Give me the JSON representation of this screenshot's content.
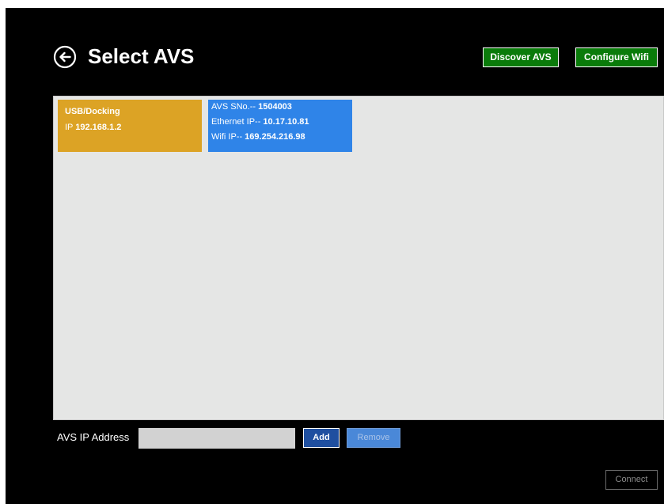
{
  "colors": {
    "background": "#000000",
    "primary_button": "#0a7b0a",
    "usb_tile": "#dca325",
    "avs_tile": "#2f84e8",
    "add_button": "#1f4fa0",
    "remove_button": "#4a88d8",
    "panel": "#e5e6e5"
  },
  "header": {
    "back_icon": "back-arrow-circle-icon",
    "title": "Select AVS",
    "discover_label": "Discover AVS",
    "configure_wifi_label": "Configure Wifi"
  },
  "devices": {
    "usb": {
      "name": "USB/Docking",
      "ip_prefix": "IP",
      "ip": "192.168.1.2"
    },
    "avs": {
      "serial_label": "AVS SNo.--",
      "serial": "1504003",
      "ethernet_label": "Ethernet IP--",
      "ethernet_ip": "10.17.10.81",
      "wifi_label": "Wifi IP--",
      "wifi_ip": "169.254.216.98"
    }
  },
  "ip_entry": {
    "label": "AVS IP Address",
    "value": "",
    "add_label": "Add",
    "remove_label": "Remove"
  },
  "footer": {
    "connect_label": "Connect"
  }
}
